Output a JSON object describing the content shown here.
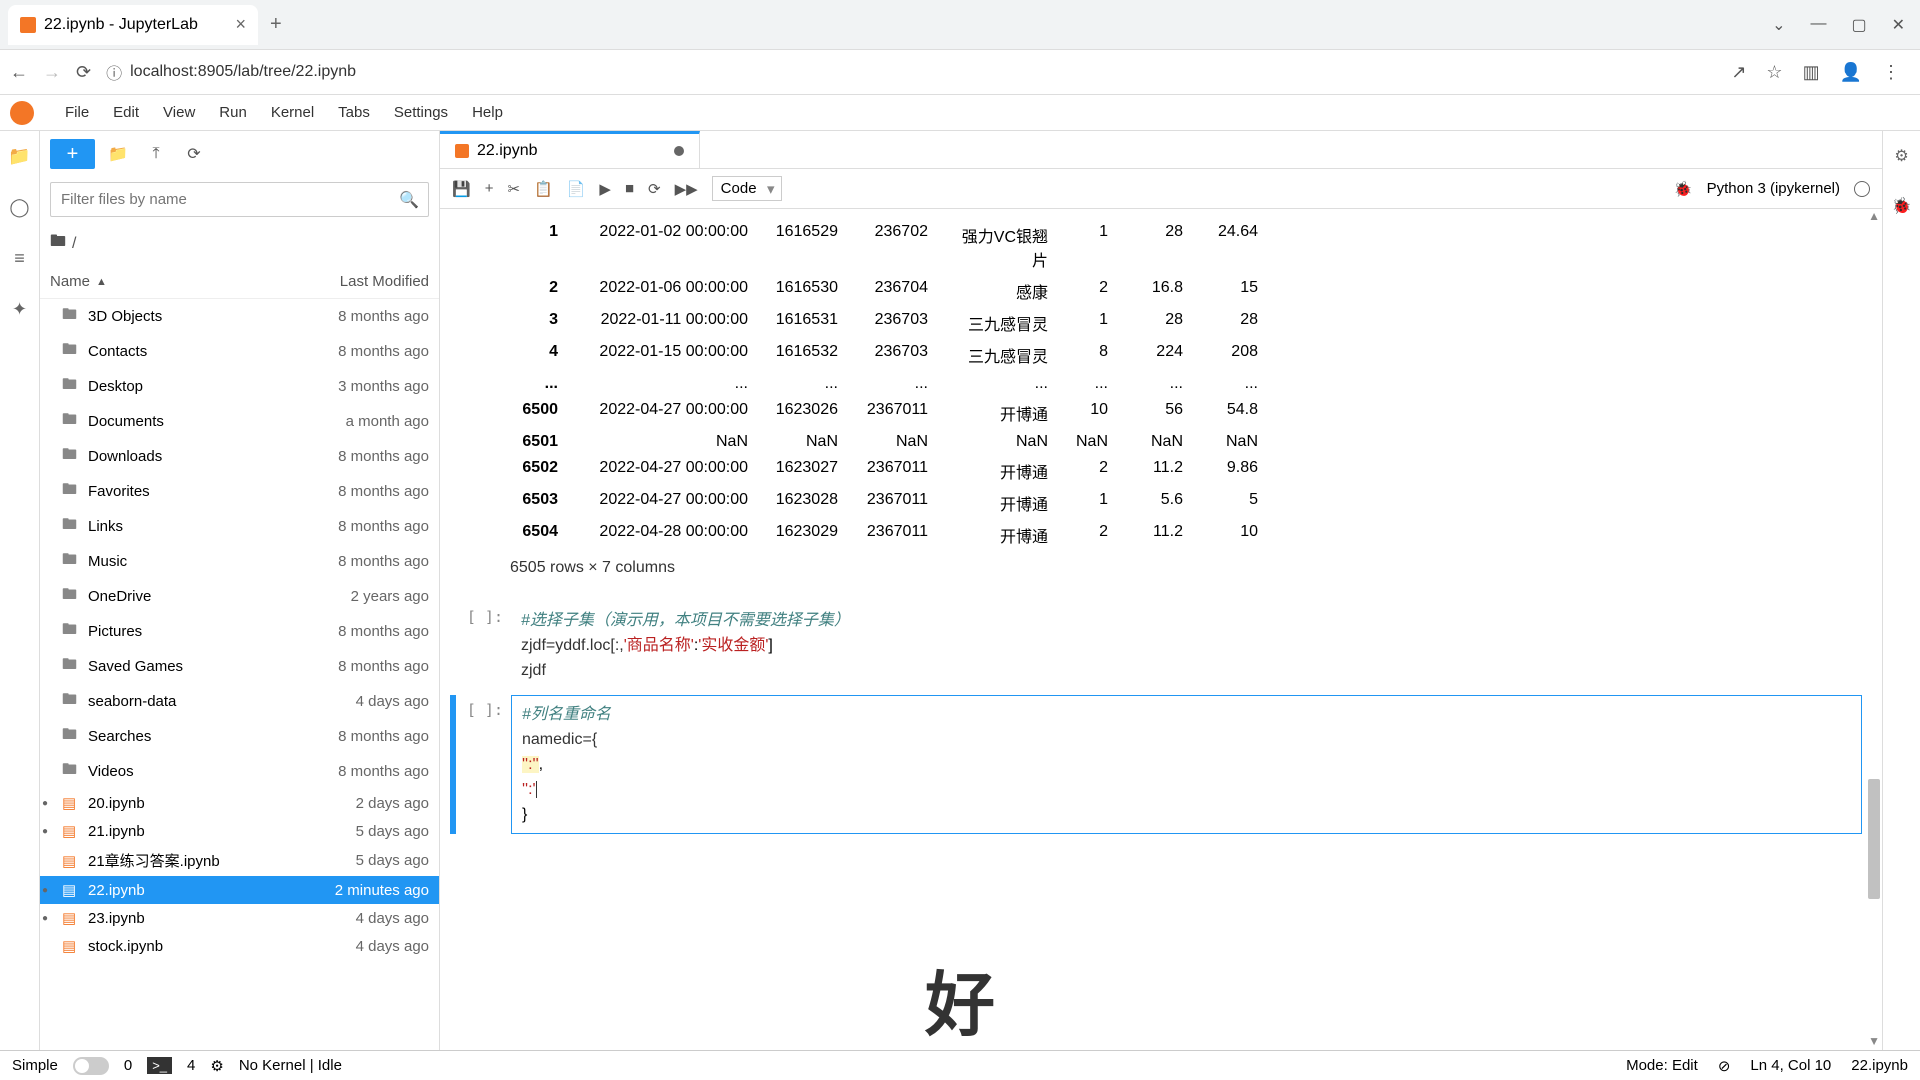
{
  "browser": {
    "tab_title": "22.ipynb - JupyterLab",
    "url": "localhost:8905/lab/tree/22.ipynb"
  },
  "menu": {
    "items": [
      "File",
      "Edit",
      "View",
      "Run",
      "Kernel",
      "Tabs",
      "Settings",
      "Help"
    ]
  },
  "sidebar": {
    "filter_placeholder": "Filter files by name",
    "path": "/",
    "headers": {
      "name": "Name",
      "modified": "Last Modified"
    },
    "files": [
      {
        "icon": "folder",
        "name": "3D Objects",
        "mod": "8 months ago",
        "dot": false,
        "nb": false
      },
      {
        "icon": "folder",
        "name": "Contacts",
        "mod": "8 months ago",
        "dot": false,
        "nb": false
      },
      {
        "icon": "folder",
        "name": "Desktop",
        "mod": "3 months ago",
        "dot": false,
        "nb": false
      },
      {
        "icon": "folder",
        "name": "Documents",
        "mod": "a month ago",
        "dot": false,
        "nb": false
      },
      {
        "icon": "folder",
        "name": "Downloads",
        "mod": "8 months ago",
        "dot": false,
        "nb": false
      },
      {
        "icon": "folder",
        "name": "Favorites",
        "mod": "8 months ago",
        "dot": false,
        "nb": false
      },
      {
        "icon": "folder",
        "name": "Links",
        "mod": "8 months ago",
        "dot": false,
        "nb": false
      },
      {
        "icon": "folder",
        "name": "Music",
        "mod": "8 months ago",
        "dot": false,
        "nb": false
      },
      {
        "icon": "folder",
        "name": "OneDrive",
        "mod": "2 years ago",
        "dot": false,
        "nb": false
      },
      {
        "icon": "folder",
        "name": "Pictures",
        "mod": "8 months ago",
        "dot": false,
        "nb": false
      },
      {
        "icon": "folder",
        "name": "Saved Games",
        "mod": "8 months ago",
        "dot": false,
        "nb": false
      },
      {
        "icon": "folder",
        "name": "seaborn-data",
        "mod": "4 days ago",
        "dot": false,
        "nb": false
      },
      {
        "icon": "folder",
        "name": "Searches",
        "mod": "8 months ago",
        "dot": false,
        "nb": false
      },
      {
        "icon": "folder",
        "name": "Videos",
        "mod": "8 months ago",
        "dot": false,
        "nb": false
      },
      {
        "icon": "nb",
        "name": "20.ipynb",
        "mod": "2 days ago",
        "dot": true,
        "nb": true
      },
      {
        "icon": "nb",
        "name": "21.ipynb",
        "mod": "5 days ago",
        "dot": true,
        "nb": true
      },
      {
        "icon": "nb",
        "name": "21章练习答案.ipynb",
        "mod": "5 days ago",
        "dot": false,
        "nb": true
      },
      {
        "icon": "nb",
        "name": "22.ipynb",
        "mod": "2 minutes ago",
        "dot": true,
        "nb": true,
        "selected": true
      },
      {
        "icon": "nb",
        "name": "23.ipynb",
        "mod": "4 days ago",
        "dot": true,
        "nb": true
      },
      {
        "icon": "nb",
        "name": "stock.ipynb",
        "mod": "4 days ago",
        "dot": false,
        "nb": true
      }
    ]
  },
  "notebook": {
    "tab_name": "22.ipynb",
    "cell_type": "Code",
    "kernel": "Python 3 (ipykernel)",
    "table_rows": [
      {
        "idx": "1",
        "c1": "2022-01-02 00:00:00",
        "c2": "1616529",
        "c3": "236702",
        "c4": "强力VC银翘片",
        "c5": "1",
        "c6": "28",
        "c7": "24.64"
      },
      {
        "idx": "2",
        "c1": "2022-01-06 00:00:00",
        "c2": "1616530",
        "c3": "236704",
        "c4": "感康",
        "c5": "2",
        "c6": "16.8",
        "c7": "15"
      },
      {
        "idx": "3",
        "c1": "2022-01-11 00:00:00",
        "c2": "1616531",
        "c3": "236703",
        "c4": "三九感冒灵",
        "c5": "1",
        "c6": "28",
        "c7": "28"
      },
      {
        "idx": "4",
        "c1": "2022-01-15 00:00:00",
        "c2": "1616532",
        "c3": "236703",
        "c4": "三九感冒灵",
        "c5": "8",
        "c6": "224",
        "c7": "208"
      },
      {
        "idx": "...",
        "c1": "...",
        "c2": "...",
        "c3": "...",
        "c4": "...",
        "c5": "...",
        "c6": "...",
        "c7": "..."
      },
      {
        "idx": "6500",
        "c1": "2022-04-27 00:00:00",
        "c2": "1623026",
        "c3": "2367011",
        "c4": "开博通",
        "c5": "10",
        "c6": "56",
        "c7": "54.8"
      },
      {
        "idx": "6501",
        "c1": "NaN",
        "c2": "NaN",
        "c3": "NaN",
        "c4": "NaN",
        "c5": "NaN",
        "c6": "NaN",
        "c7": "NaN"
      },
      {
        "idx": "6502",
        "c1": "2022-04-27 00:00:00",
        "c2": "1623027",
        "c3": "2367011",
        "c4": "开博通",
        "c5": "2",
        "c6": "11.2",
        "c7": "9.86"
      },
      {
        "idx": "6503",
        "c1": "2022-04-27 00:00:00",
        "c2": "1623028",
        "c3": "2367011",
        "c4": "开博通",
        "c5": "1",
        "c6": "5.6",
        "c7": "5"
      },
      {
        "idx": "6504",
        "c1": "2022-04-28 00:00:00",
        "c2": "1623029",
        "c3": "2367011",
        "c4": "开博通",
        "c5": "2",
        "c6": "11.2",
        "c7": "10"
      }
    ],
    "table_summary": "6505 rows × 7 columns",
    "cell1": {
      "comment": "#选择子集（演示用，本项目不需要选择子集）",
      "line2a": "zjdf=yddf.loc[:,",
      "line2b": "'商品名称'",
      "line2c": ":",
      "line2d": "'实收金额'",
      "line2e": "]",
      "line3": "zjdf"
    },
    "cell2": {
      "comment": "#列名重命名",
      "line2": "namedic={",
      "line3": "    '':''",
      "line3b": ",",
      "line4": "    '':'",
      "line5": "}"
    }
  },
  "status": {
    "simple": "Simple",
    "term_count": "0",
    "kern_count": "4",
    "kernel_status": "No Kernel | Idle",
    "mode": "Mode: Edit",
    "pos": "Ln 4, Col 10",
    "file": "22.ipynb"
  },
  "overlay_char": "好"
}
